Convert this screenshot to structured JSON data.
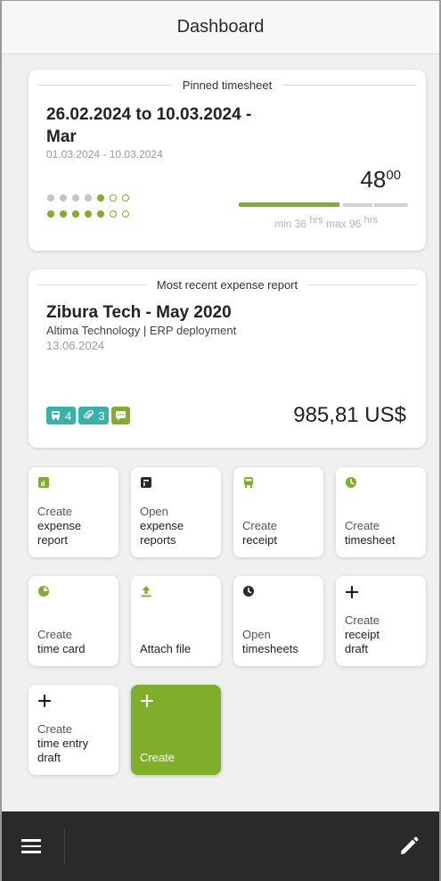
{
  "header": {
    "title": "Dashboard"
  },
  "pinned_timesheet": {
    "legend": "Pinned timesheet",
    "title": "26.02.2024 to 10.03.2024 - Mar",
    "date_range": "01.03.2024 - 10.03.2024",
    "hours_main": "48",
    "hours_minor": "00",
    "progress_fraction": 0.48,
    "min_label": "min 36",
    "max_label": "max 96",
    "unit": "hrs",
    "dot_rows": [
      [
        "gray",
        "gray",
        "gray",
        "gray",
        "green",
        "ring",
        "ring"
      ],
      [
        "green",
        "green",
        "green",
        "green",
        "green",
        "ring",
        "ring"
      ]
    ]
  },
  "expense_report": {
    "legend": "Most recent expense report",
    "title": "Zibura Tech - May 2020",
    "subtitle": "Altima Technology | ERP deployment",
    "date": "13.06.2024",
    "receipts_count": "4",
    "attachments_count": "3",
    "amount": "985,81 US$"
  },
  "tiles": [
    {
      "line1": "Create",
      "line2": "expense",
      "line3": "report",
      "icon": "chart-icon"
    },
    {
      "line1": "Open",
      "line2": "expense",
      "line3": "reports",
      "icon": "report-icon"
    },
    {
      "line1": "Create",
      "line2": "receipt",
      "line3": "",
      "icon": "receipt-icon"
    },
    {
      "line1": "Create",
      "line2": "timesheet",
      "line3": "",
      "icon": "clock-icon"
    },
    {
      "line1": "Create",
      "line2": "time card",
      "line3": "",
      "icon": "pie-icon"
    },
    {
      "line1": "",
      "line2": "Attach file",
      "line3": "",
      "icon": "upload-icon"
    },
    {
      "line1": "Open",
      "line2": "timesheets",
      "line3": "",
      "icon": "clock-icon"
    },
    {
      "line1": "Create",
      "line2": "receipt",
      "line3": "draft",
      "icon": "plus-icon"
    },
    {
      "line1": "Create",
      "line2": "time entry",
      "line3": "draft",
      "icon": "plus-icon"
    },
    {
      "line1": "",
      "line2": "Create",
      "line3": "",
      "icon": "plus-icon"
    }
  ],
  "colors": {
    "accent_green": "#7fae2a",
    "accent_teal": "#36b3a9",
    "bottom_bar": "#2a2a2a"
  }
}
